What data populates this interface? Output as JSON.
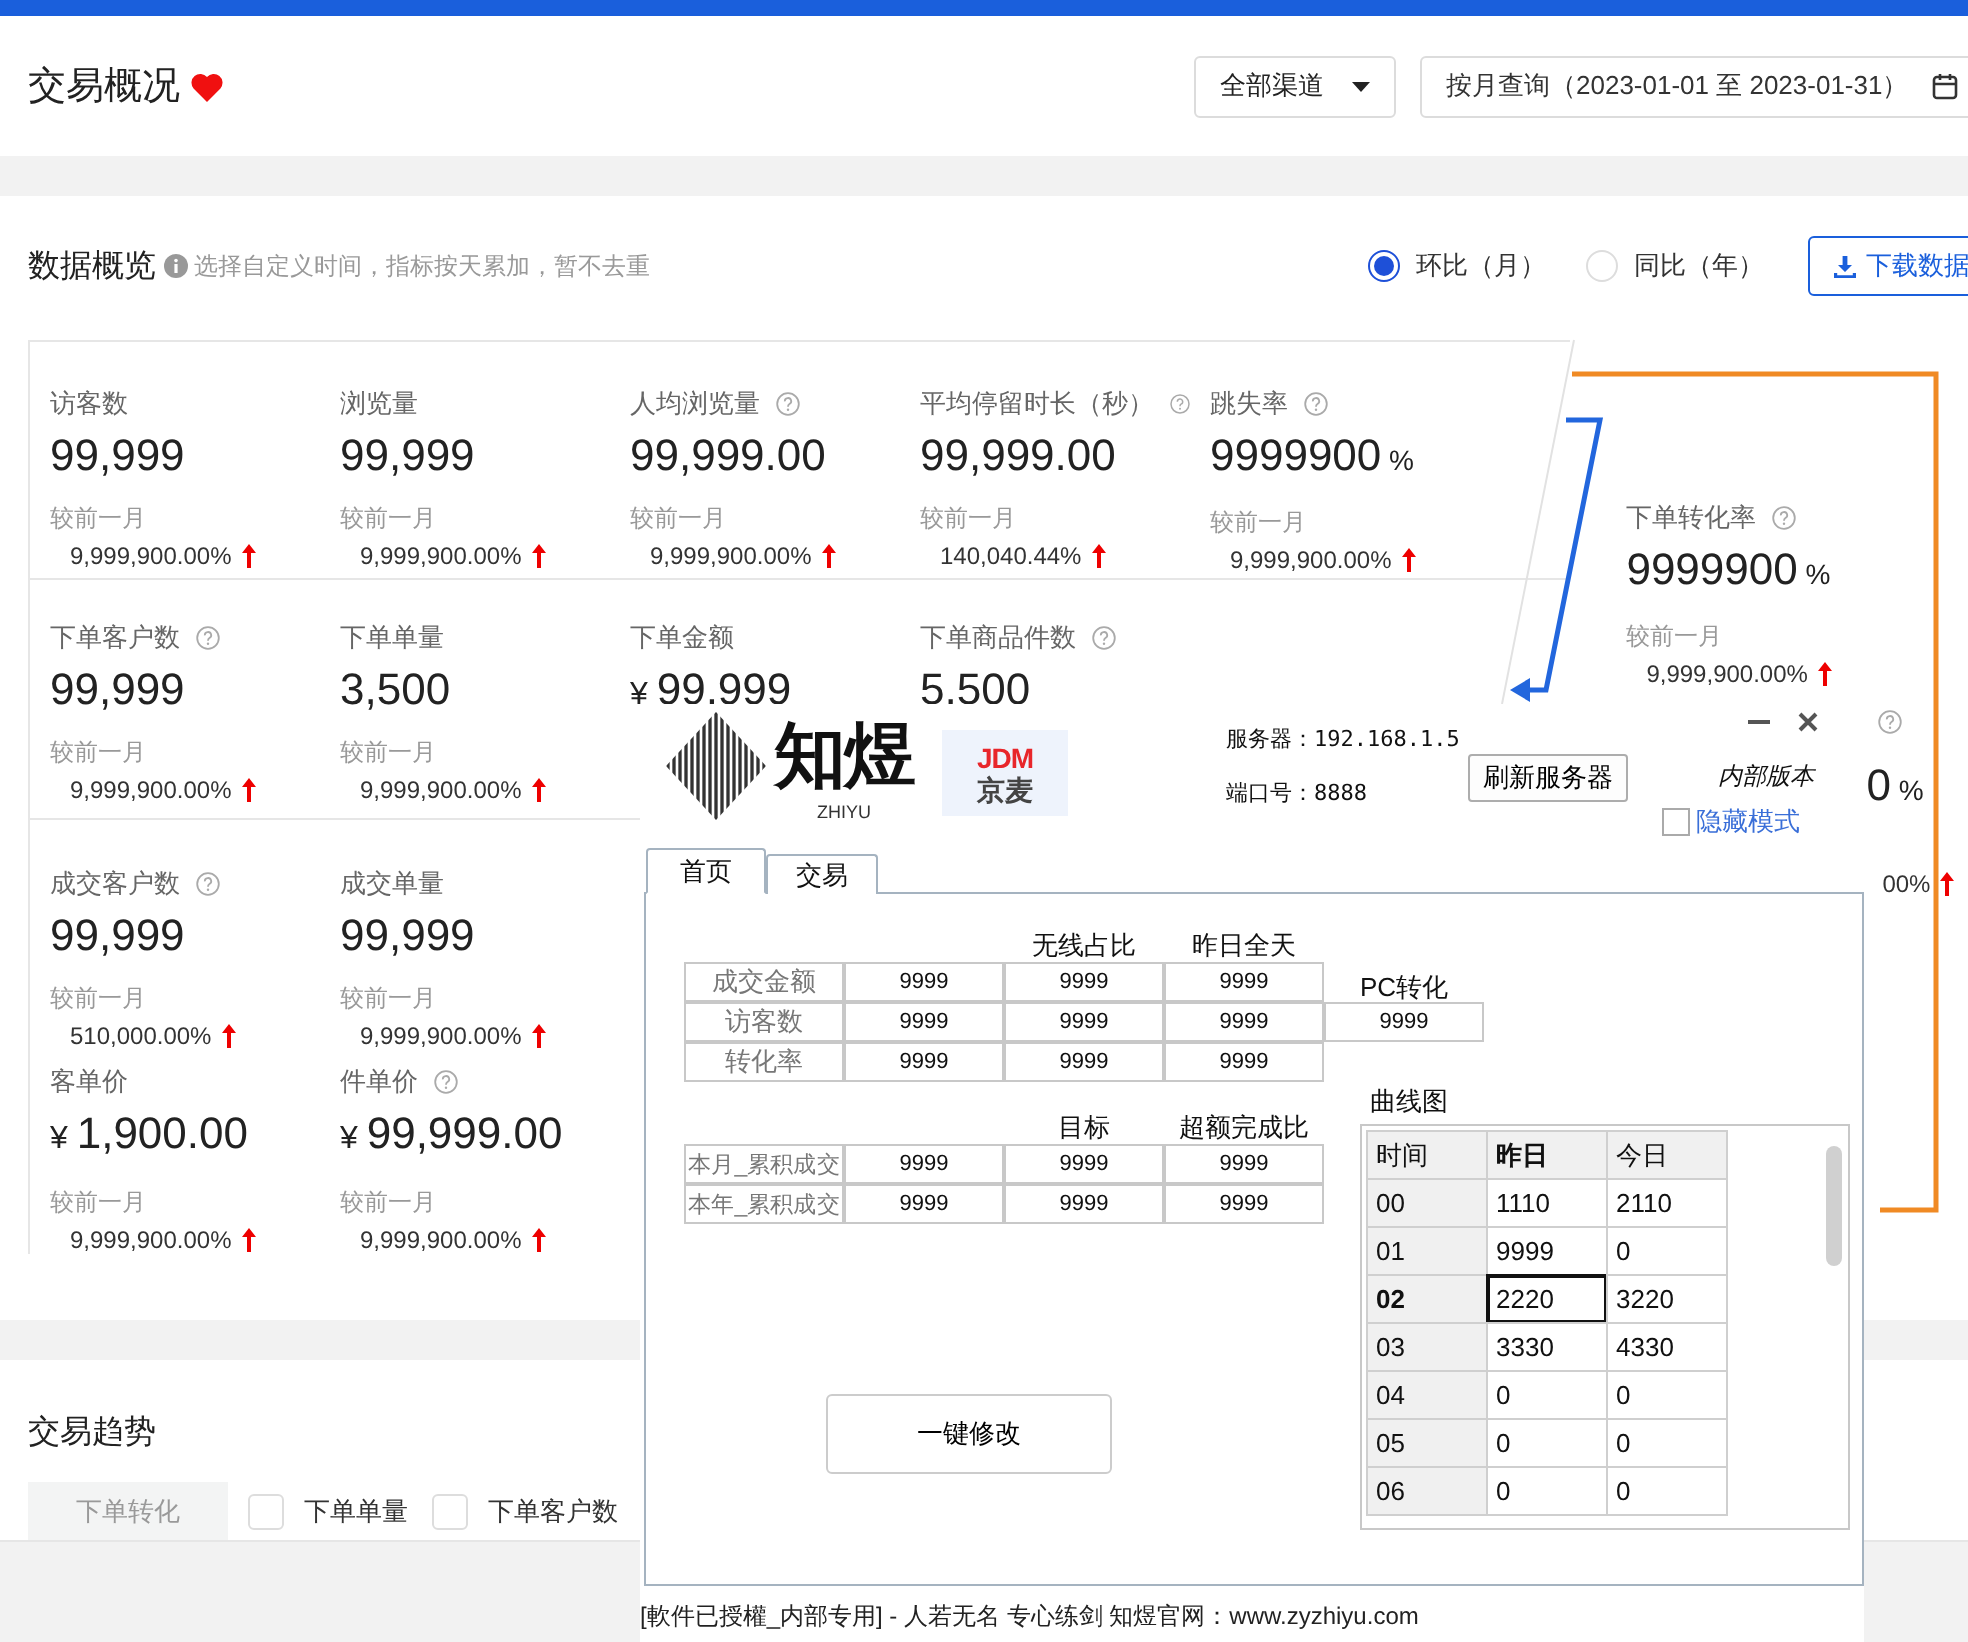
{
  "header": {
    "title": "交易概况",
    "channel_select": "全部渠道",
    "date_range": "按月查询（2023-01-01 至 2023-01-31）"
  },
  "overview": {
    "title": "数据概览",
    "hint": "选择自定义时间，指标按天累加，暂不去重",
    "compare_options": [
      {
        "label": "环比（月）",
        "selected": true
      },
      {
        "label": "同比（年）",
        "selected": false
      }
    ],
    "download_button": "下载数据"
  },
  "metric_rows": [
    {
      "cards": [
        {
          "label": "访客数",
          "help": false,
          "value": "99,999",
          "compare_label": "较前一月",
          "change": "9,999,900.00%",
          "increase": true
        },
        {
          "label": "浏览量",
          "help": false,
          "value": "99,999",
          "compare_label": "较前一月",
          "change": "9,999,900.00%",
          "increase": true
        },
        {
          "label": "人均浏览量",
          "help": true,
          "value": "99,999.00",
          "compare_label": "较前一月",
          "change": "9,999,900.00%",
          "increase": true
        },
        {
          "label": "平均停留时长（秒）",
          "help": true,
          "value": "99,999.00",
          "compare_label": "较前一月",
          "change": "140,040.44%",
          "increase": true
        },
        {
          "label": "跳失率",
          "help": true,
          "value": "9999900",
          "unit": "%",
          "compare_label": "较前一月",
          "change": "9,999,900.00%",
          "increase": true
        }
      ]
    },
    {
      "cards": [
        {
          "label": "下单客户数",
          "help": true,
          "value": "99,999",
          "compare_label": "较前一月",
          "change": "9,999,900.00%",
          "increase": true
        },
        {
          "label": "下单单量",
          "help": false,
          "value": "3,500",
          "compare_label": "较前一月",
          "change": "9,999,900.00%",
          "increase": true
        },
        {
          "label": "下单金额",
          "help": false,
          "prefix": "¥",
          "value": "99,999"
        },
        {
          "label": "下单商品件数",
          "help": true,
          "value": "5,500"
        }
      ]
    },
    {
      "cards": [
        {
          "label": "成交客户数",
          "help": true,
          "value": "99,999",
          "compare_label": "较前一月",
          "change": "510,000.00%",
          "increase": true
        },
        {
          "label": "成交单量",
          "help": false,
          "value": "99,999",
          "compare_label": "较前一月",
          "change": "9,999,900.00%",
          "increase": true
        }
      ]
    },
    {
      "cards": [
        {
          "label": "客单价",
          "help": false,
          "prefix": "¥",
          "value": "1,900.00",
          "compare_label": "较前一月",
          "change": "9,999,900.00%",
          "increase": true
        },
        {
          "label": "件单价",
          "help": true,
          "prefix": "¥",
          "value": "99,999.00",
          "compare_label": "较前一月",
          "change": "9,999,900.00%",
          "increase": true
        }
      ]
    }
  ],
  "side_metrics": [
    {
      "label": "下单转化率",
      "help": true,
      "value": "9999900",
      "unit": "%",
      "compare_label": "较前一月",
      "change": "9,999,900.00%",
      "increase": true
    },
    {
      "help": true,
      "value": "0",
      "unit": "%",
      "change": "00%",
      "increase": true
    }
  ],
  "trend": {
    "title": "交易趋势",
    "series_options": [
      {
        "label": "下单转化",
        "kind": "tab",
        "selected": true
      },
      {
        "label": "下单单量",
        "kind": "checkbox",
        "checked": false
      },
      {
        "label": "下单客户数",
        "kind": "checkbox",
        "checked": false
      }
    ]
  },
  "tool_window": {
    "brand": {
      "name": "知煜",
      "latin": "ZHIYU"
    },
    "partner_logo": {
      "top": "JDM",
      "bottom": "京麦"
    },
    "server": "服务器：192.168.1.5",
    "port": "端口号：8888",
    "refresh_button": "刷新服务器",
    "version": "内部版本",
    "hide_mode": {
      "label": "隐藏模式",
      "checked": false
    },
    "tabs": [
      {
        "label": "首页",
        "selected": true
      },
      {
        "label": "交易",
        "selected": false
      }
    ],
    "summary_table": {
      "headers": [
        "无线占比",
        "昨日全天"
      ],
      "rows": [
        {
          "label": "成交金额",
          "cells": [
            "9999",
            "9999",
            "9999"
          ]
        },
        {
          "label": "访客数",
          "cells": [
            "9999",
            "9999",
            "9999"
          ]
        },
        {
          "label": "转化率",
          "cells": [
            "9999",
            "9999",
            "9999"
          ]
        }
      ]
    },
    "pc_conversion": {
      "label": "PC转化",
      "value": "9999"
    },
    "target_table": {
      "headers": [
        "目标",
        "超额完成比"
      ],
      "rows": [
        {
          "label": "本月_累积成交",
          "cells": [
            "9999",
            "9999",
            "9999"
          ]
        },
        {
          "label": "本年_累积成交",
          "cells": [
            "9999",
            "9999",
            "9999"
          ]
        }
      ]
    },
    "modify_button": "一键修改",
    "curve": {
      "title": "曲线图",
      "columns": [
        {
          "label": "时间",
          "selected": false
        },
        {
          "label": "昨日",
          "selected": true
        },
        {
          "label": "今日",
          "selected": false
        }
      ],
      "rows": [
        {
          "cells": [
            "00",
            "1110",
            "2110"
          ],
          "selected": false
        },
        {
          "cells": [
            "01",
            "9999",
            "0"
          ],
          "selected": false
        },
        {
          "cells": [
            "02",
            "2220",
            "3220"
          ],
          "selected": true
        },
        {
          "cells": [
            "03",
            "3330",
            "4330"
          ],
          "selected": false
        },
        {
          "cells": [
            "04",
            "0",
            "0"
          ],
          "selected": false
        },
        {
          "cells": [
            "05",
            "0",
            "0"
          ],
          "selected": false
        },
        {
          "cells": [
            "06",
            "0",
            "0"
          ],
          "selected": false
        }
      ]
    },
    "footer": "[軟件已授權_内部专用] - 人若无名 专心练剑 知煜官网：www.zyzhiyu.com"
  }
}
